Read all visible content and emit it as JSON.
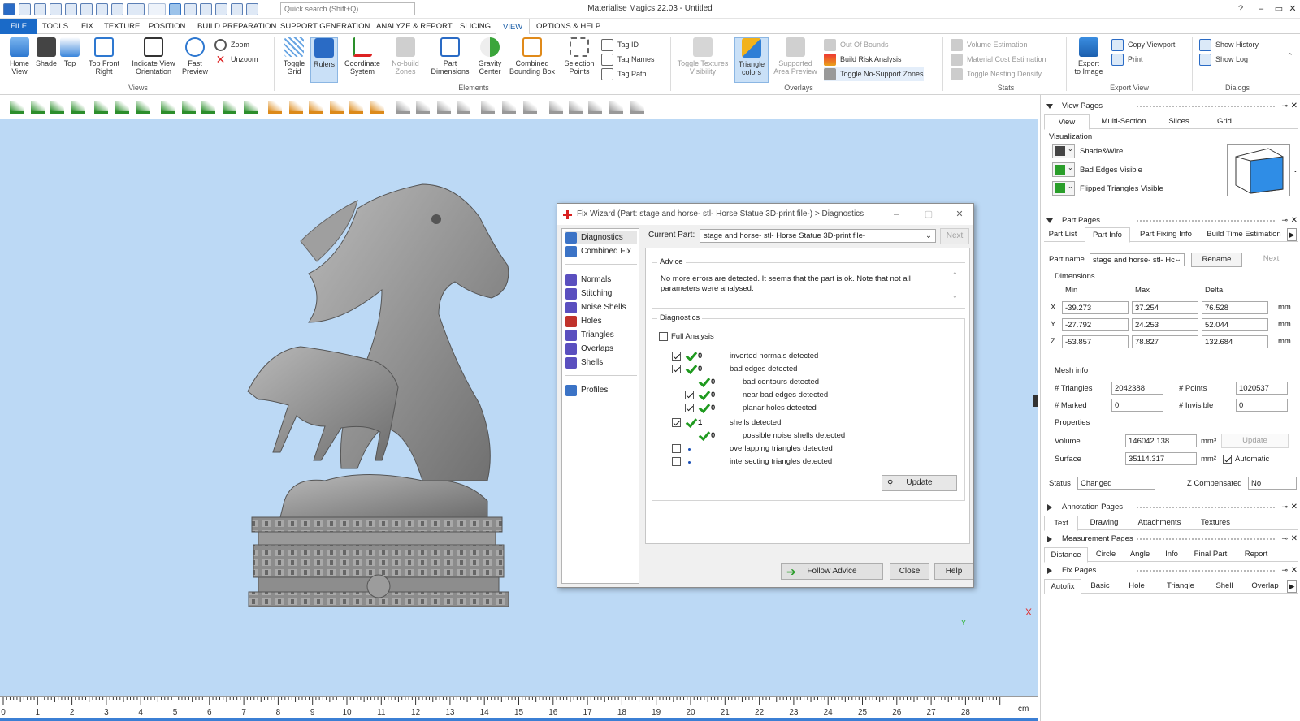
{
  "app": {
    "title": "Materialise Magics 22.03 - Untitled",
    "search_placeholder": "Quick search (Shift+Q)"
  },
  "menu_tabs": [
    "FILE",
    "TOOLS",
    "FIX",
    "TEXTURE",
    "POSITION",
    "BUILD PREPARATION",
    "SUPPORT GENERATION",
    "ANALYZE & REPORT",
    "SLICING",
    "VIEW",
    "OPTIONS & HELP"
  ],
  "active_tab": "VIEW",
  "ribbon": {
    "views": {
      "label": "Views",
      "home": "Home\nView",
      "shade": "Shade",
      "top": "Top",
      "top_front_right": "Top Front\nRight",
      "indicate_view": "Indicate View\nOrientation",
      "fast_preview": "Fast\nPreview",
      "zoom": "Zoom",
      "unzoom": "Unzoom"
    },
    "elements": {
      "label": "Elements",
      "toggle_grid": "Toggle\nGrid",
      "rulers": "Rulers",
      "coordinate_system": "Coordinate\nSystem",
      "no_build_zones": "No-build\nZones",
      "part_dimensions": "Part\nDimensions",
      "gravity_center": "Gravity\nCenter",
      "combined_bbox": "Combined\nBounding Box",
      "selection_points": "Selection\nPoints",
      "tag_id": "Tag ID",
      "tag_names": "Tag Names",
      "tag_path": "Tag Path"
    },
    "overlays": {
      "label": "Overlays",
      "toggle_textures": "Toggle Textures\nVisibility",
      "triangle_colors": "Triangle\ncolors",
      "supported_area": "Supported\nArea Preview",
      "out_of_bounds": "Out Of Bounds",
      "build_risk": "Build Risk Analysis",
      "toggle_no_support": "Toggle No-Support Zones"
    },
    "stats": {
      "label": "Stats",
      "volume_est": "Volume Estimation",
      "material_cost": "Material Cost Estimation",
      "toggle_nesting": "Toggle Nesting Density"
    },
    "export_view": {
      "label": "Export View",
      "export_image": "Export\nto Image",
      "copy_viewport": "Copy Viewport",
      "print": "Print"
    },
    "dialogs": {
      "label": "Dialogs",
      "show_history": "Show History",
      "show_log": "Show Log"
    }
  },
  "ruler": {
    "ticks": [
      "0",
      "1",
      "2",
      "3",
      "4",
      "5",
      "6",
      "7",
      "8",
      "9",
      "10",
      "11",
      "12",
      "13",
      "14",
      "15",
      "16",
      "17",
      "18",
      "19",
      "20",
      "21",
      "22",
      "23",
      "24",
      "25",
      "26",
      "27",
      "28"
    ],
    "unit": "cm"
  },
  "axes": {
    "x_label": "X",
    "y_label": "Y"
  },
  "dialog": {
    "title": "Fix Wizard (Part: stage and horse- stl- Horse Statue 3D-print file-) > Diagnostics",
    "nav": [
      "Diagnostics",
      "Combined Fix",
      "Normals",
      "Stitching",
      "Noise Shells",
      "Holes",
      "Triangles",
      "Overlaps",
      "Shells",
      "Profiles"
    ],
    "current_part_label": "Current Part:",
    "current_part": "stage and horse- stl- Horse Statue 3D-print file-",
    "next": "Next",
    "advice_title": "Advice",
    "advice_text": "No more errors are detected. It seems that the part is ok. Note that not all parameters were analysed.",
    "diagnostics_title": "Diagnostics",
    "full_analysis": "Full Analysis",
    "rows": [
      {
        "count": "0",
        "text": "inverted normals detected"
      },
      {
        "count": "0",
        "text": "bad edges detected"
      },
      {
        "count": "0",
        "text": "bad contours detected"
      },
      {
        "count": "0",
        "text": "near bad edges detected"
      },
      {
        "count": "0",
        "text": "planar holes detected"
      },
      {
        "count": "1",
        "text": "shells detected"
      },
      {
        "count": "0",
        "text": "possible noise shells detected"
      },
      {
        "count": "",
        "text": "overlapping triangles detected"
      },
      {
        "count": "",
        "text": "intersecting triangles detected"
      }
    ],
    "update": "Update",
    "follow_advice": "Follow Advice",
    "close": "Close",
    "help": "Help"
  },
  "panel": {
    "view_pages": "View Pages",
    "view_tabs": [
      "View",
      "Multi-Section",
      "Slices",
      "Grid"
    ],
    "visualization": "Visualization",
    "vis_items": [
      "Shade&Wire",
      "Bad Edges Visible",
      "Flipped Triangles Visible"
    ],
    "part_pages": "Part Pages",
    "part_tabs": [
      "Part List",
      "Part Info",
      "Part Fixing Info",
      "Build Time Estimation"
    ],
    "part_name_label": "Part name",
    "part_name": "stage and horse- stl- Hc",
    "rename": "Rename",
    "next": "Next",
    "dimensions": "Dimensions",
    "dim_headers": [
      "Min",
      "Max",
      "Delta"
    ],
    "dims": [
      {
        "axis": "X",
        "min": "-39.273",
        "max": "37.254",
        "delta": "76.528",
        "unit": "mm"
      },
      {
        "axis": "Y",
        "min": "-27.792",
        "max": "24.253",
        "delta": "52.044",
        "unit": "mm"
      },
      {
        "axis": "Z",
        "min": "-53.857",
        "max": "78.827",
        "delta": "132.684",
        "unit": "mm"
      }
    ],
    "mesh_info": "Mesh info",
    "triangles_label": "# Triangles",
    "triangles": "2042388",
    "points_label": "# Points",
    "points": "1020537",
    "marked_label": "# Marked",
    "marked": "0",
    "invisible_label": "# Invisible",
    "invisible": "0",
    "properties": "Properties",
    "volume_label": "Volume",
    "volume": "146042.138",
    "volume_unit": "mm³",
    "surface_label": "Surface",
    "surface": "35114.317",
    "surface_unit": "mm²",
    "update": "Update",
    "automatic": "Automatic",
    "status_label": "Status",
    "status": "Changed",
    "zcomp_label": "Z Compensated",
    "zcomp": "No",
    "annotation_pages": "Annotation Pages",
    "annotation_tabs": [
      "Text",
      "Drawing",
      "Attachments",
      "Textures"
    ],
    "measurement_pages": "Measurement Pages",
    "measurement_tabs": [
      "Distance",
      "Circle",
      "Angle",
      "Info",
      "Final Part",
      "Report"
    ],
    "fix_pages": "Fix Pages",
    "fix_tabs": [
      "Autofix",
      "Basic",
      "Hole",
      "Triangle",
      "Shell",
      "Overlap"
    ]
  }
}
